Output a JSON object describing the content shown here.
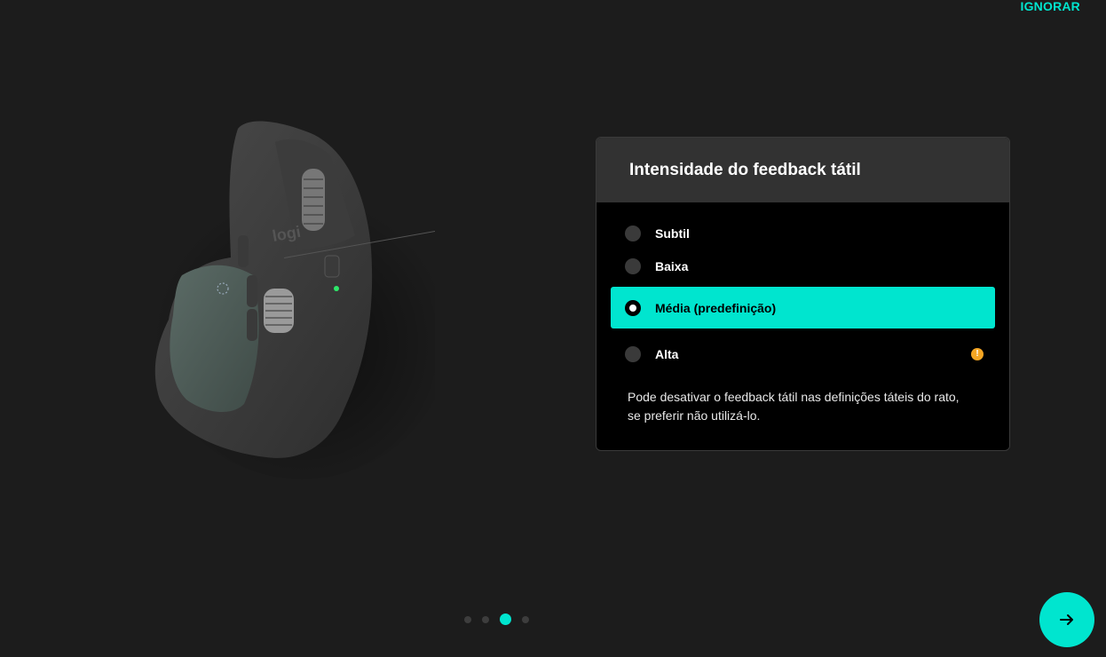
{
  "header": {
    "skip_label": "IGNORAR"
  },
  "device": {
    "brand_mark": "logi",
    "icon": "mouse-image"
  },
  "card": {
    "title": "Intensidade do feedback tátil",
    "options": [
      {
        "label": "Subtil",
        "selected": false
      },
      {
        "label": "Baixa",
        "selected": false
      },
      {
        "label": "Média (predefinição)",
        "selected": true
      },
      {
        "label": "Alta",
        "selected": false,
        "warning_icon": "warning-icon",
        "warning_glyph": "!"
      }
    ],
    "note_line1": "Pode desativar o feedback tátil nas definições táteis do rato,",
    "note_line2": "se preferir não utilizá-lo."
  },
  "pager": {
    "count": 4,
    "active_index": 2
  },
  "footer": {
    "next_icon": "arrow-right-icon"
  },
  "colors": {
    "accent": "#00e5cf",
    "background": "#1c1c1c",
    "card": "#000000",
    "card_header": "#323232",
    "warning": "#f5a623"
  }
}
